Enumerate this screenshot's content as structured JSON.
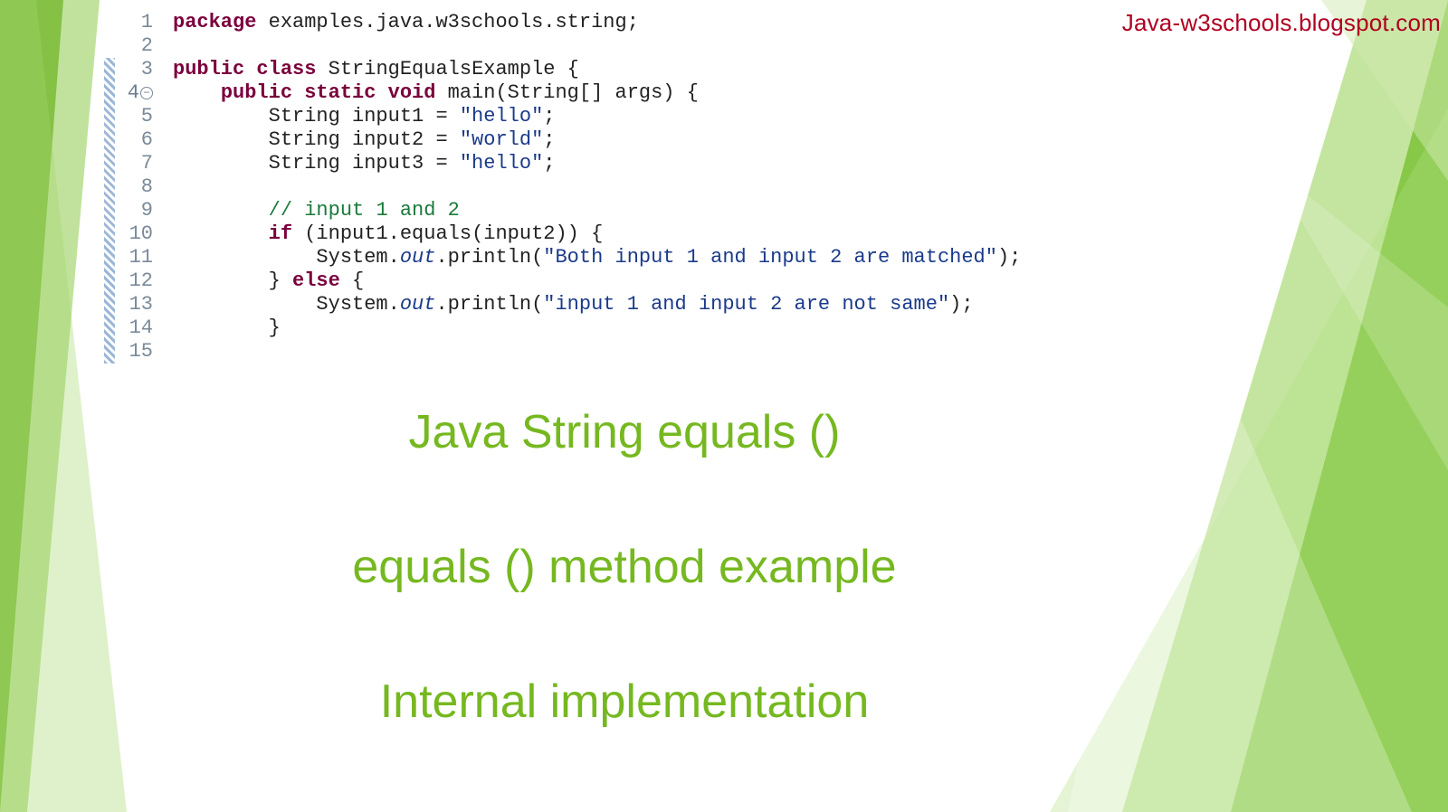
{
  "watermark": "Java-w3schools.blogspot.com",
  "titles": {
    "line1": "Java String equals ()",
    "line2": "equals () method example",
    "line3": "Internal implementation"
  },
  "code": {
    "lineNumbers": [
      "1",
      "2",
      "3",
      "4",
      "5",
      "6",
      "7",
      "8",
      "9",
      "10",
      "11",
      "12",
      "13",
      "14",
      "15"
    ],
    "foldLine": "4",
    "changeBarFromLine": 3,
    "lines": [
      {
        "segments": [
          {
            "cls": "kw",
            "t": "package"
          },
          {
            "cls": "plain",
            "t": " examples.java.w3schools.string;"
          }
        ]
      },
      {
        "segments": [
          {
            "cls": "plain",
            "t": ""
          }
        ]
      },
      {
        "segments": [
          {
            "cls": "kw",
            "t": "public class"
          },
          {
            "cls": "plain",
            "t": " StringEqualsExample {"
          }
        ]
      },
      {
        "segments": [
          {
            "cls": "plain",
            "t": "    "
          },
          {
            "cls": "kw",
            "t": "public static void"
          },
          {
            "cls": "plain",
            "t": " main(String[] args) {"
          }
        ]
      },
      {
        "segments": [
          {
            "cls": "plain",
            "t": "        String input1 = "
          },
          {
            "cls": "str",
            "t": "\"hello\""
          },
          {
            "cls": "plain",
            "t": ";"
          }
        ]
      },
      {
        "segments": [
          {
            "cls": "plain",
            "t": "        String input2 = "
          },
          {
            "cls": "str",
            "t": "\"world\""
          },
          {
            "cls": "plain",
            "t": ";"
          }
        ]
      },
      {
        "segments": [
          {
            "cls": "plain",
            "t": "        String input3 = "
          },
          {
            "cls": "str",
            "t": "\"hello\""
          },
          {
            "cls": "plain",
            "t": ";"
          }
        ]
      },
      {
        "segments": [
          {
            "cls": "plain",
            "t": ""
          }
        ]
      },
      {
        "segments": [
          {
            "cls": "plain",
            "t": "        "
          },
          {
            "cls": "cmt",
            "t": "// input 1 and 2"
          }
        ]
      },
      {
        "segments": [
          {
            "cls": "plain",
            "t": "        "
          },
          {
            "cls": "kw",
            "t": "if"
          },
          {
            "cls": "plain",
            "t": " (input1.equals(input2)) {"
          }
        ]
      },
      {
        "segments": [
          {
            "cls": "plain",
            "t": "            System."
          },
          {
            "cls": "stat",
            "t": "out"
          },
          {
            "cls": "plain",
            "t": ".println("
          },
          {
            "cls": "str",
            "t": "\"Both input 1 and input 2 are matched\""
          },
          {
            "cls": "plain",
            "t": ");"
          }
        ]
      },
      {
        "segments": [
          {
            "cls": "plain",
            "t": "        } "
          },
          {
            "cls": "kw",
            "t": "else"
          },
          {
            "cls": "plain",
            "t": " {"
          }
        ]
      },
      {
        "segments": [
          {
            "cls": "plain",
            "t": "            System."
          },
          {
            "cls": "stat",
            "t": "out"
          },
          {
            "cls": "plain",
            "t": ".println("
          },
          {
            "cls": "str",
            "t": "\"input 1 and input 2 are not same\""
          },
          {
            "cls": "plain",
            "t": ");"
          }
        ]
      },
      {
        "segments": [
          {
            "cls": "plain",
            "t": "        }"
          }
        ]
      },
      {
        "segments": [
          {
            "cls": "plain",
            "t": ""
          }
        ]
      }
    ]
  }
}
